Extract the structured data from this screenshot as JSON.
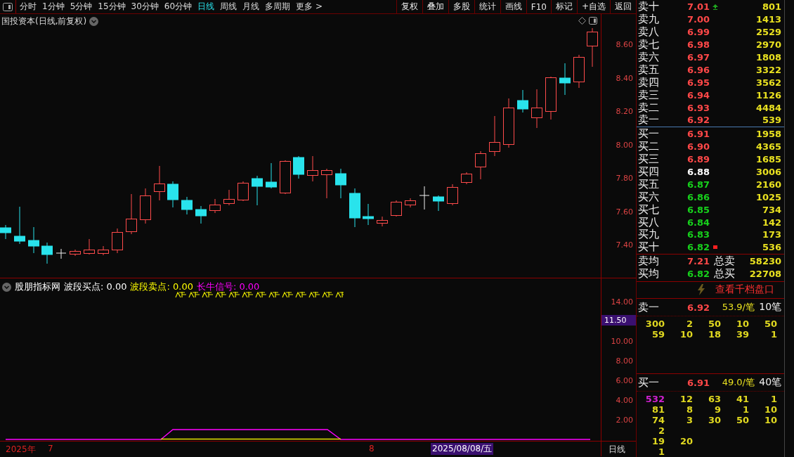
{
  "toolbar": {
    "periods": [
      {
        "label": "分时",
        "selected": false
      },
      {
        "label": "1分钟",
        "selected": false
      },
      {
        "label": "5分钟",
        "selected": false
      },
      {
        "label": "15分钟",
        "selected": false
      },
      {
        "label": "30分钟",
        "selected": false
      },
      {
        "label": "60分钟",
        "selected": false
      },
      {
        "label": "日线",
        "selected": true
      },
      {
        "label": "周线",
        "selected": false
      },
      {
        "label": "月线",
        "selected": false
      },
      {
        "label": "多周期",
        "selected": false
      },
      {
        "label": "更多 >",
        "selected": false
      }
    ],
    "buttons": [
      "复权",
      "叠加",
      "多股",
      "统计",
      "画线",
      "F10",
      "标记",
      "+自选",
      "返回"
    ]
  },
  "chart": {
    "title": "国投资本(日线,前复权)",
    "price_ticks": [
      "8.60",
      "8.40",
      "8.20",
      "8.00",
      "7.80",
      "7.60",
      "7.40"
    ]
  },
  "indicator": {
    "legend": [
      {
        "text": "股朋指标网",
        "color": "#ffffff"
      },
      {
        "text": "波段买点: 0.00",
        "color": "#ffffff"
      },
      {
        "text": "波段卖点: 0.00",
        "color": "#ffff00"
      },
      {
        "text": "长牛信号: 0.00",
        "color": "#ff00ff"
      }
    ],
    "ticks": [
      "14.00",
      "10.00",
      "8.00",
      "6.00",
      "4.00",
      "2.00"
    ],
    "cursor_value": "11.50"
  },
  "timeline": {
    "year": "2025年",
    "months": [
      "7",
      "8"
    ],
    "cursor_date": "2025/08/08/五",
    "period": "日线"
  },
  "order_book": {
    "asks": [
      {
        "kind": "arrow",
        "label": "卖十",
        "price": "7.01",
        "volume": "801",
        "color": "#ff4848"
      },
      {
        "kind": "plain",
        "label": "卖九",
        "price": "7.00",
        "volume": "1413",
        "color": "#ff4848"
      },
      {
        "kind": "plain",
        "label": "卖八",
        "price": "6.99",
        "volume": "2529",
        "color": "#ff4848"
      },
      {
        "kind": "plain",
        "label": "卖七",
        "price": "6.98",
        "volume": "2970",
        "color": "#ff4848"
      },
      {
        "kind": "plain",
        "label": "卖六",
        "price": "6.97",
        "volume": "1808",
        "color": "#ff4848"
      },
      {
        "kind": "plain",
        "label": "卖五",
        "price": "6.96",
        "volume": "3322",
        "color": "#ff4848"
      },
      {
        "kind": "plain",
        "label": "卖四",
        "price": "6.95",
        "volume": "3562",
        "color": "#ff4848"
      },
      {
        "kind": "plain",
        "label": "卖三",
        "price": "6.94",
        "volume": "1126",
        "color": "#ff4848"
      },
      {
        "kind": "plain",
        "label": "卖二",
        "price": "6.93",
        "volume": "4484",
        "color": "#ff4848"
      },
      {
        "kind": "plain",
        "label": "卖一",
        "price": "6.92",
        "volume": "539",
        "color": "#ff4848"
      }
    ],
    "bids": [
      {
        "kind": "plain",
        "label": "买一",
        "price": "6.91",
        "volume": "1958",
        "color": "#ff4848"
      },
      {
        "kind": "plain",
        "label": "买二",
        "price": "6.90",
        "volume": "4365",
        "color": "#ff4848"
      },
      {
        "kind": "plain",
        "label": "买三",
        "price": "6.89",
        "volume": "1685",
        "color": "#ff4848"
      },
      {
        "kind": "plain",
        "label": "买四",
        "price": "6.88",
        "volume": "3006",
        "color": "#ffffff"
      },
      {
        "kind": "plain",
        "label": "买五",
        "price": "6.87",
        "volume": "2160",
        "color": "#17d01c"
      },
      {
        "kind": "plain",
        "label": "买六",
        "price": "6.86",
        "volume": "1025",
        "color": "#17d01c"
      },
      {
        "kind": "plain",
        "label": "买七",
        "price": "6.85",
        "volume": "734",
        "color": "#17d01c"
      },
      {
        "kind": "plain",
        "label": "买八",
        "price": "6.84",
        "volume": "142",
        "color": "#17d01c"
      },
      {
        "kind": "plain",
        "label": "买九",
        "price": "6.83",
        "volume": "173",
        "color": "#17d01c"
      },
      {
        "kind": "square",
        "label": "买十",
        "price": "6.82",
        "volume": "536",
        "color": "#17d01c"
      }
    ],
    "summary": [
      {
        "label": "卖均",
        "price": "7.21",
        "color": "#ff4848",
        "total_label": "总卖",
        "total": "58230"
      },
      {
        "label": "买均",
        "price": "6.82",
        "color": "#17d01c",
        "total_label": "总买",
        "total": "22708"
      }
    ],
    "depth_link": "查看千档盘口",
    "queues": [
      {
        "label": "卖一",
        "price": "6.92",
        "average": "53.9/笔",
        "count": "10笔",
        "rows": [
          {
            "cells": [
              "300",
              "2",
              "50",
              "10",
              "50"
            ],
            "highlight_first": false
          },
          {
            "cells": [
              "59",
              "10",
              "18",
              "39",
              "1"
            ],
            "highlight_first": false
          }
        ]
      },
      {
        "label": "买一",
        "price": "6.91",
        "average": "49.0/笔",
        "count": "40笔",
        "rows": [
          {
            "cells": [
              "532",
              "12",
              "63",
              "41",
              "1"
            ],
            "highlight_first": true
          },
          {
            "cells": [
              "81",
              "8",
              "9",
              "1",
              "10"
            ],
            "highlight_first": false
          },
          {
            "cells": [
              "74",
              "3",
              "30",
              "50",
              "10"
            ],
            "highlight_first": false
          },
          {
            "cells": [
              "2"
            ],
            "highlight_first": false
          },
          {
            "cells": [
              "19",
              "20"
            ],
            "highlight_first": false
          },
          {
            "cells": [
              "1"
            ],
            "highlight_first": false
          }
        ]
      }
    ]
  }
}
